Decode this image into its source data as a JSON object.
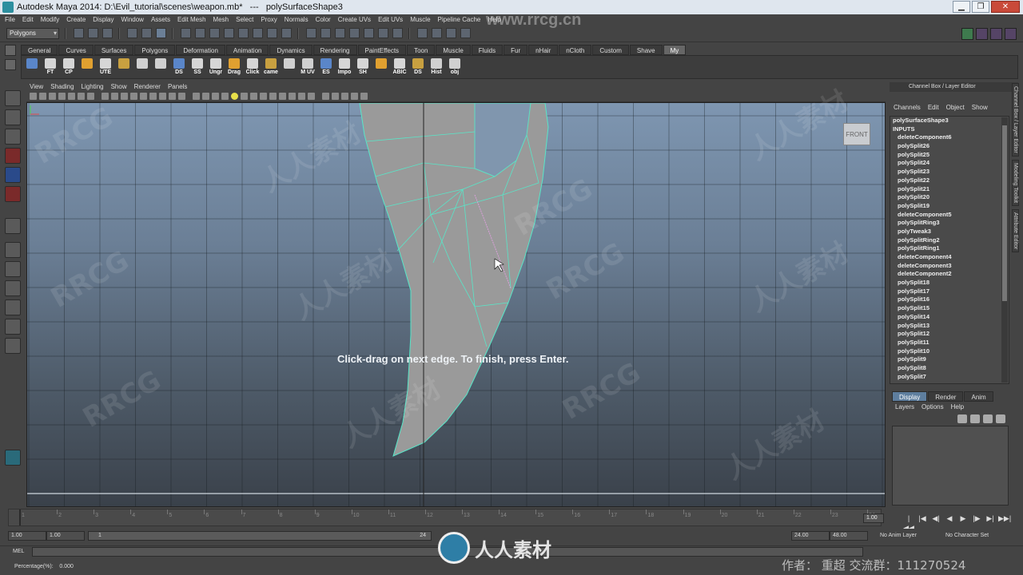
{
  "window": {
    "title": "Autodesk Maya 2014: D:\\Evil_tutorial\\scenes\\weapon.mb*   ---   polySurfaceShape3",
    "buttons": [
      "▁",
      "❐",
      "✕"
    ]
  },
  "menubar": [
    "File",
    "Edit",
    "Modify",
    "Create",
    "Display",
    "Window",
    "Assets",
    "Edit Mesh",
    "Mesh",
    "Select",
    "Proxy",
    "Normals",
    "Color",
    "Create UVs",
    "Edit UVs",
    "Muscle",
    "Pipeline Cache",
    "Help"
  ],
  "statusline": {
    "mode": "Polygons"
  },
  "shelf": {
    "tabs": [
      "General",
      "Curves",
      "Surfaces",
      "Polygons",
      "Deformation",
      "Animation",
      "Dynamics",
      "Rendering",
      "PaintEffects",
      "Toon",
      "Muscle",
      "Fluids",
      "Fur",
      "nHair",
      "nCloth",
      "Custom",
      "Shave",
      "My"
    ],
    "active_tab": "My",
    "buttons": [
      "",
      "FT",
      "CP",
      "",
      "UTE",
      "",
      "",
      "",
      "DS",
      "SS",
      "Ungr",
      "Drag",
      "Click",
      "came",
      "",
      "M UV",
      "ES",
      "Impo",
      "SH",
      "",
      "ABIC",
      "DS",
      "Hist",
      "obj"
    ]
  },
  "panel": {
    "menu": [
      "View",
      "Shading",
      "Lighting",
      "Show",
      "Renderer",
      "Panels"
    ],
    "camera": "FRONT",
    "hint": "Click-drag on next edge. To finish, press Enter."
  },
  "channel_box": {
    "header": "Channel Box / Layer Editor",
    "menu": [
      "Channels",
      "Edit",
      "Object",
      "Show"
    ],
    "title": "polySurfaceShape3",
    "inputs_label": "INPUTS",
    "items": [
      "deleteComponent6",
      "polySplit26",
      "polySplit25",
      "polySplit24",
      "polySplit23",
      "polySplit22",
      "polySplit21",
      "polySplit20",
      "polySplit19",
      "deleteComponent5",
      "polySplitRing3",
      "polyTweak3",
      "polySplitRing2",
      "polySplitRing1",
      "deleteComponent4",
      "deleteComponent3",
      "deleteComponent2",
      "polySplit18",
      "polySplit17",
      "polySplit16",
      "polySplit15",
      "polySplit14",
      "polySplit13",
      "polySplit12",
      "polySplit11",
      "polySplit10",
      "polySplit9",
      "polySplit8",
      "polySplit7"
    ],
    "side_tabs": [
      "Channel Box / Layer Editor",
      "Modeling Toolkit",
      "Attribute Editor"
    ]
  },
  "layer_editor": {
    "tabs": [
      "Display",
      "Render",
      "Anim"
    ],
    "active_tab": "Display",
    "menu": [
      "Layers",
      "Options",
      "Help"
    ]
  },
  "timeline": {
    "ticks": [
      "1",
      "2",
      "3",
      "4",
      "5",
      "6",
      "7",
      "8",
      "9",
      "10",
      "11",
      "12",
      "13",
      "14",
      "15",
      "16",
      "17",
      "18",
      "19",
      "20",
      "21",
      "22",
      "23",
      "24"
    ],
    "current": "1.00",
    "playback_buttons": [
      "|◀◀",
      "|◀",
      "◀|",
      "◀",
      "▶",
      "|▶",
      "▶|",
      "▶▶|"
    ]
  },
  "range": {
    "start": "1.00",
    "anim_start": "1.00",
    "bar_start": "1",
    "bar_end": "24",
    "end": "24.00",
    "anim_end": "48.00",
    "anim_layer": "No Anim Layer",
    "character_set": "No Character Set"
  },
  "command_line": {
    "label": "MEL"
  },
  "help_line": {
    "text": "Percentage(%):    0.000"
  },
  "overlay": {
    "watermark_top": "www.rrcg.cn",
    "watermarks": [
      "RRCG",
      "人人素材",
      "RRCG",
      "人人素材",
      "RRCG",
      "人人素材",
      "RRCG",
      "人人素材",
      "RRCG",
      "人人素材",
      "RRCG",
      "人人素材"
    ],
    "brand": "人人素材",
    "credit": "作者：  重超    交流群：111270524"
  },
  "colors": {
    "wire": "#58e6c8",
    "mesh": "#9a9a9a",
    "viewport_top": "#7e96b1"
  }
}
